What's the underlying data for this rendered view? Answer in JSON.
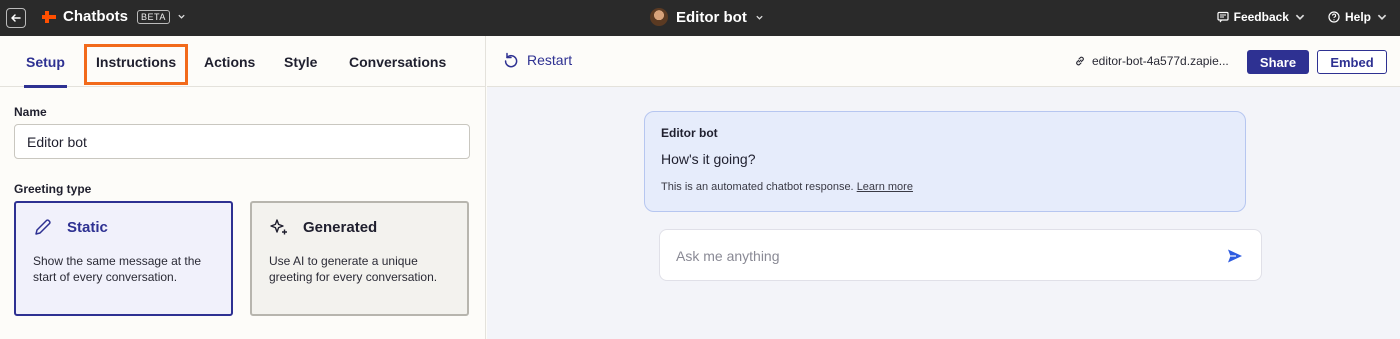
{
  "topbar": {
    "app_name": "Chatbots",
    "badge": "BETA",
    "bot_title": "Editor bot",
    "feedback_label": "Feedback",
    "help_label": "Help"
  },
  "tabs": [
    {
      "label": "Setup",
      "active": true
    },
    {
      "label": "Instructions",
      "active": false,
      "highlighted": true
    },
    {
      "label": "Actions",
      "active": false
    },
    {
      "label": "Style",
      "active": false
    },
    {
      "label": "Conversations",
      "active": false
    }
  ],
  "setup": {
    "name_label": "Name",
    "name_value": "Editor bot",
    "greeting_label": "Greeting type",
    "cards": [
      {
        "title": "Static",
        "icon": "pencil-icon",
        "description": "Show the same message at the start of every conversation.",
        "selected": true
      },
      {
        "title": "Generated",
        "icon": "sparkles-icon",
        "description": "Use AI to generate a unique greeting for every conversation.",
        "selected": false
      }
    ]
  },
  "preview": {
    "restart_label": "Restart",
    "url": "editor-bot-4a577d.zapie...",
    "share_label": "Share",
    "embed_label": "Embed",
    "message": {
      "sender": "Editor bot",
      "text": "How's it going?",
      "note": "This is an automated chatbot response.",
      "note_link": "Learn more"
    },
    "input_placeholder": "Ask me anything"
  },
  "colors": {
    "accent": "#2e3192",
    "highlight": "#f26a1b",
    "topbar_bg": "#2a2a2a",
    "brand_orange": "#ff4f00"
  }
}
